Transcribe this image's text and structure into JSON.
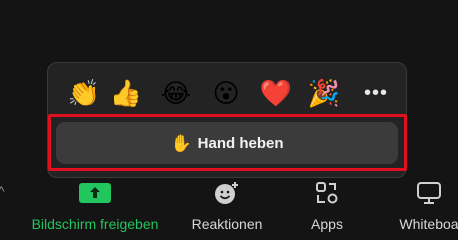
{
  "reactions_popup": {
    "emojis": [
      {
        "name": "clapping-hands",
        "glyph": "👏"
      },
      {
        "name": "thumbs-up",
        "glyph": "👍"
      },
      {
        "name": "tears-of-joy",
        "glyph": "😂"
      },
      {
        "name": "open-mouth",
        "glyph": "😮"
      },
      {
        "name": "red-heart",
        "glyph": "❤️"
      },
      {
        "name": "party-popper",
        "glyph": "🎉"
      }
    ],
    "more_label": "•••",
    "hand_button": {
      "icon": "✋",
      "label": "Hand heben"
    }
  },
  "toolbar": {
    "share_screen": {
      "label": "Bildschirm freigeben",
      "icon": "share-screen-icon",
      "color": "#22c55e"
    },
    "reactions": {
      "label": "Reaktionen",
      "icon": "reactions-icon"
    },
    "apps": {
      "label": "Apps",
      "icon": "apps-icon"
    },
    "whiteboard": {
      "label": "Whiteboa",
      "icon": "whiteboard-icon"
    }
  },
  "colors": {
    "background": "#141414",
    "popup": "#232323",
    "hand_button": "#3b3b3b",
    "highlight": "#e0101e",
    "share_green": "#22c55e"
  }
}
